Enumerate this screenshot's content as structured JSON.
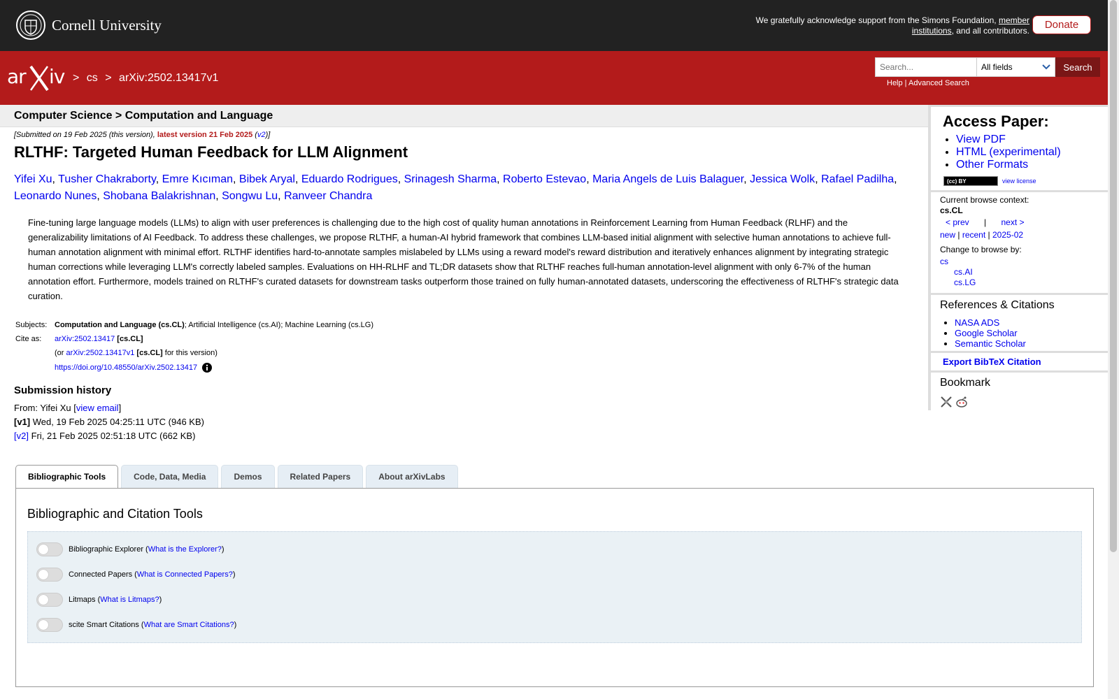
{
  "top": {
    "university": "Cornell University",
    "support_text": "We gratefully acknowledge support from the Simons Foundation,",
    "member_link": "member institutions",
    "support_tail": ", and all contributors.",
    "donate": "Donate"
  },
  "header": {
    "crumb_cs": "cs",
    "crumb_id": "arXiv:2502.13417v1",
    "search_placeholder": "Search...",
    "field_select": "All fields",
    "search_button": "Search",
    "help": "Help",
    "advanced": "Advanced Search"
  },
  "paper": {
    "subject_heading": "Computer Science > Computation and Language",
    "submitted": "[Submitted on 19 Feb 2025 (this version), ",
    "latest": "latest version 21 Feb 2025",
    "v2_open": " (",
    "v2": "v2",
    "v2_close": ")]",
    "title": "RLTHF: Targeted Human Feedback for LLM Alignment",
    "authors": [
      "Yifei Xu",
      "Tusher Chakraborty",
      "Emre Kıcıman",
      "Bibek Aryal",
      "Eduardo Rodrigues",
      "Srinagesh Sharma",
      "Roberto Estevao",
      "Maria Angels de Luis Balaguer",
      "Jessica Wolk",
      "Rafael Padilha",
      "Leonardo Nunes",
      "Shobana Balakrishnan",
      "Songwu Lu",
      "Ranveer Chandra"
    ],
    "abstract": "Fine-tuning large language models (LLMs) to align with user preferences is challenging due to the high cost of quality human annotations in Reinforcement Learning from Human Feedback (RLHF) and the generalizability limitations of AI Feedback. To address these challenges, we propose RLTHF, a human-AI hybrid framework that combines LLM-based initial alignment with selective human annotations to achieve full-human annotation alignment with minimal effort. RLTHF identifies hard-to-annotate samples mislabeled by LLMs using a reward model's reward distribution and iteratively enhances alignment by integrating strategic human corrections while leveraging LLM's correctly labeled samples. Evaluations on HH-RLHF and TL;DR datasets show that RLTHF reaches full-human annotation-level alignment with only 6-7% of the human annotation effort. Furthermore, models trained on RLTHF's curated datasets for downstream tasks outperform those trained on fully human-annotated datasets, underscoring the effectiveness of RLTHF's strategic data curation.",
    "subjects_label": "Subjects:",
    "subjects_primary": "Computation and Language (cs.CL)",
    "subjects_rest": "; Artificial Intelligence (cs.AI); Machine Learning (cs.LG)",
    "cite_label": "Cite as:",
    "cite_id": "arXiv:2502.13417",
    "cite_cat": "[cs.CL]",
    "cite_or": "(or ",
    "cite_v1": "arXiv:2502.13417v1",
    "cite_v1_cat": "[cs.CL]",
    "cite_v1_tail": " for this version)",
    "doi": "https://doi.org/10.48550/arXiv.2502.13417"
  },
  "history": {
    "heading": "Submission history",
    "from": "From: Yifei Xu [",
    "view_email": "view email",
    "from_close": "]",
    "v1_label": "[v1]",
    "v1_text": " Wed, 19 Feb 2025 04:25:11 UTC (946 KB)",
    "v2_label": "[v2]",
    "v2_text": " Fri, 21 Feb 2025 02:51:18 UTC (662 KB)"
  },
  "tabs": [
    "Bibliographic Tools",
    "Code, Data, Media",
    "Demos",
    "Related Papers",
    "About arXivLabs"
  ],
  "panel": {
    "title": "Bibliographic and Citation Tools",
    "tools": [
      {
        "name": "Bibliographic Explorer",
        "link": "What is the Explorer?"
      },
      {
        "name": "Connected Papers",
        "link": "What is Connected Papers?"
      },
      {
        "name": "Litmaps",
        "link": "What is Litmaps?"
      },
      {
        "name": "scite Smart Citations",
        "link": "What are Smart Citations?"
      }
    ]
  },
  "sidebar": {
    "access_heading": "Access Paper:",
    "access_links": [
      "View PDF",
      "HTML (experimental)",
      "Other Formats"
    ],
    "cc_badge": "(cc) BY",
    "view_license": "view license",
    "browse_context_label": "Current browse context:",
    "browse_context": "cs.CL",
    "prev": "< prev",
    "sep": "|",
    "next": "next >",
    "new": "new",
    "recent": "recent",
    "month": "2025-02",
    "change_label": "Change to browse by:",
    "browse_cs": "cs",
    "browse_ai": "cs.AI",
    "browse_lg": "cs.LG",
    "refs_heading": "References & Citations",
    "refs_links": [
      "NASA ADS",
      "Google Scholar",
      "Semantic Scholar"
    ],
    "export": "Export BibTeX Citation",
    "bookmark_heading": "Bookmark"
  }
}
